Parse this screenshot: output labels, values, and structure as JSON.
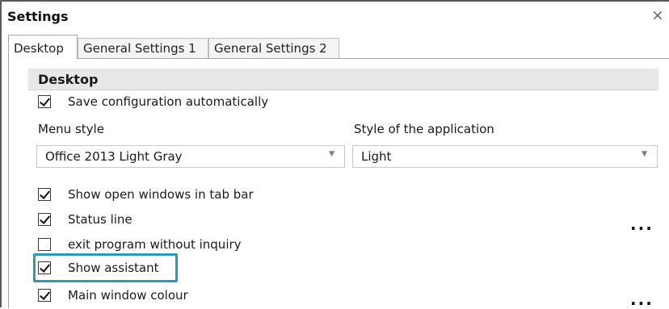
{
  "window": {
    "title": "Settings",
    "close_glyph": "×"
  },
  "tabs": [
    {
      "label": "Desktop",
      "active": true
    },
    {
      "label": "General Settings 1",
      "active": false
    },
    {
      "label": "General Settings 2",
      "active": false
    }
  ],
  "section": {
    "title": "Desktop"
  },
  "options": {
    "save_config": {
      "label": "Save configuration automatically",
      "checked": true
    },
    "show_open_windows": {
      "label": "Show open windows in tab bar",
      "checked": true
    },
    "status_line": {
      "label": "Status line",
      "checked": true
    },
    "exit_without_inquiry": {
      "label": "exit program without inquiry",
      "checked": false
    },
    "show_assistant": {
      "label": "Show assistant",
      "checked": true
    },
    "main_window_colour": {
      "label": "Main window colour",
      "checked": true
    }
  },
  "menu_style": {
    "label": "Menu style",
    "value": "Office 2013 Light Gray"
  },
  "app_style": {
    "label": "Style of the application",
    "value": "Light"
  },
  "more_button_glyph": "...",
  "colors": {
    "highlight": "#2a9ab5",
    "section_bg": "#e8e8e8"
  }
}
